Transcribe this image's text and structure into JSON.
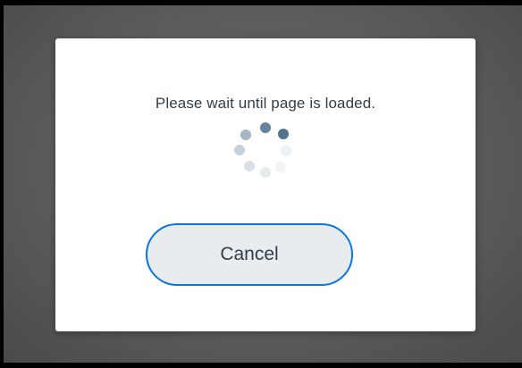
{
  "dialog": {
    "message": "Please wait until page is loaded.",
    "cancel_label": "Cancel",
    "spinner_icon": "loading-spinner-icon"
  },
  "colors": {
    "overlay": "#5c5c5c",
    "dialog_bg": "#ffffff",
    "button_bg": "#e8ecef",
    "button_border": "#0875e1",
    "text": "#333d47",
    "spinner": "#5a7d99"
  }
}
